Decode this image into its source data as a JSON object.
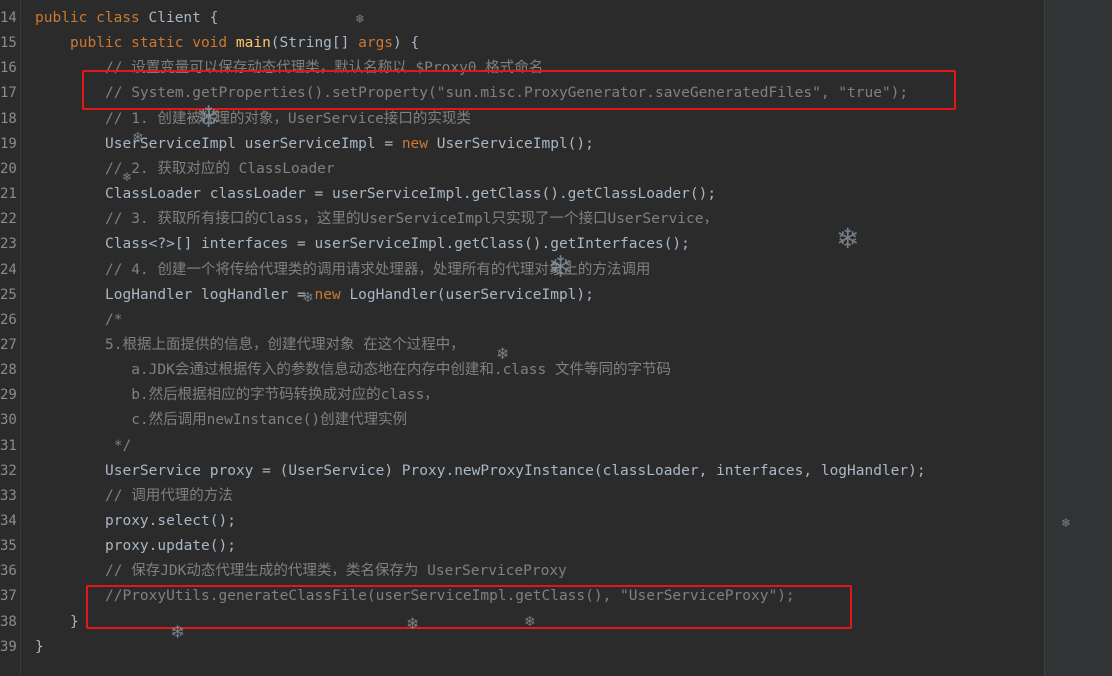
{
  "editor": {
    "lines": [
      {
        "no": "14",
        "indent": 0,
        "tokens": [
          {
            "t": "public class ",
            "c": "kw"
          },
          {
            "t": "Client {",
            "c": ""
          }
        ]
      },
      {
        "no": "15",
        "indent": 1,
        "tokens": [
          {
            "t": "public static void ",
            "c": "kw"
          },
          {
            "t": "main",
            "c": "fn"
          },
          {
            "t": "(String[] ",
            "c": ""
          },
          {
            "t": "args",
            "c": "kw"
          },
          {
            "t": ") {",
            "c": ""
          }
        ]
      },
      {
        "no": "16",
        "indent": 2,
        "tokens": [
          {
            "t": "// 设置变量可以保存动态代理类，默认名称以 $Proxy0 格式命名",
            "c": "cm"
          }
        ]
      },
      {
        "no": "17",
        "indent": 2,
        "tokens": [
          {
            "t": "// System.getProperties().setProperty(\"sun.misc.ProxyGenerator.saveGeneratedFiles\", \"true\");",
            "c": "cm"
          }
        ]
      },
      {
        "no": "18",
        "indent": 2,
        "tokens": [
          {
            "t": "// 1. 创建被代理的对象，UserService接口的实现类",
            "c": "cm"
          }
        ]
      },
      {
        "no": "19",
        "indent": 2,
        "tokens": [
          {
            "t": "UserServiceImpl userServiceImpl = ",
            "c": ""
          },
          {
            "t": "new ",
            "c": "kw"
          },
          {
            "t": "UserServiceImpl();",
            "c": ""
          }
        ]
      },
      {
        "no": "20",
        "indent": 2,
        "tokens": [
          {
            "t": "// 2. 获取对应的 ClassLoader",
            "c": "cm"
          }
        ]
      },
      {
        "no": "21",
        "indent": 2,
        "tokens": [
          {
            "t": "ClassLoader classLoader = userServiceImpl.getClass().getClassLoader();",
            "c": ""
          }
        ]
      },
      {
        "no": "22",
        "indent": 2,
        "tokens": [
          {
            "t": "// 3. 获取所有接口的Class，这里的UserServiceImpl只实现了一个接口UserService，",
            "c": "cm"
          }
        ]
      },
      {
        "no": "23",
        "indent": 2,
        "tokens": [
          {
            "t": "Class<?>[] interfaces = userServiceImpl.getClass().getInterfaces();",
            "c": ""
          }
        ]
      },
      {
        "no": "24",
        "indent": 2,
        "tokens": [
          {
            "t": "// 4. 创建一个将传给代理类的调用请求处理器，处理所有的代理对象上的方法调用",
            "c": "cm"
          }
        ]
      },
      {
        "no": "25",
        "indent": 2,
        "tokens": [
          {
            "t": "LogHandler logHandler = ",
            "c": ""
          },
          {
            "t": "new ",
            "c": "kw"
          },
          {
            "t": "LogHandler(userServiceImpl);",
            "c": ""
          }
        ]
      },
      {
        "no": "26",
        "indent": 2,
        "tokens": [
          {
            "t": "/*",
            "c": "cm"
          }
        ]
      },
      {
        "no": "27",
        "indent": 2,
        "tokens": [
          {
            "t": "5.根据上面提供的信息，创建代理对象 在这个过程中，",
            "c": "cm"
          }
        ]
      },
      {
        "no": "28",
        "indent": 2,
        "tokens": [
          {
            "t": "   a.JDK会通过根据传入的参数信息动态地在内存中创建和.class 文件等同的字节码",
            "c": "cm"
          }
        ]
      },
      {
        "no": "29",
        "indent": 2,
        "tokens": [
          {
            "t": "   b.然后根据相应的字节码转换成对应的class，",
            "c": "cm"
          }
        ]
      },
      {
        "no": "30",
        "indent": 2,
        "tokens": [
          {
            "t": "   c.然后调用newInstance()创建代理实例",
            "c": "cm"
          }
        ]
      },
      {
        "no": "31",
        "indent": 2,
        "tokens": [
          {
            "t": " */",
            "c": "cm"
          }
        ]
      },
      {
        "no": "32",
        "indent": 2,
        "tokens": [
          {
            "t": "UserService proxy = (UserService) Proxy.newProxyInstance(classLoader, interfaces, logHandler);",
            "c": ""
          }
        ]
      },
      {
        "no": "33",
        "indent": 2,
        "tokens": [
          {
            "t": "// 调用代理的方法",
            "c": "cm"
          }
        ]
      },
      {
        "no": "34",
        "indent": 2,
        "tokens": [
          {
            "t": "proxy.select();",
            "c": ""
          }
        ]
      },
      {
        "no": "35",
        "indent": 2,
        "tokens": [
          {
            "t": "proxy.update();",
            "c": ""
          }
        ]
      },
      {
        "no": "36",
        "indent": 2,
        "tokens": [
          {
            "t": "// 保存JDK动态代理生成的代理类，类名保存为 UserServiceProxy",
            "c": "cm"
          }
        ]
      },
      {
        "no": "37",
        "indent": 2,
        "tokens": [
          {
            "t": "//ProxyUtils.generateClassFile(userServiceImpl.getClass(), \"UserServiceProxy\");",
            "c": "cm"
          }
        ]
      },
      {
        "no": "38",
        "indent": 1,
        "tokens": [
          {
            "t": "}",
            "c": ""
          }
        ]
      },
      {
        "no": "39",
        "indent": 0,
        "tokens": [
          {
            "t": "}",
            "c": ""
          }
        ]
      }
    ]
  },
  "colors": {
    "background": "#2b2b2b",
    "keyword": "#cc7832",
    "comment": "#808080",
    "method": "#ffc66d",
    "text": "#a9b7c6",
    "highlight_box": "#e01818"
  }
}
